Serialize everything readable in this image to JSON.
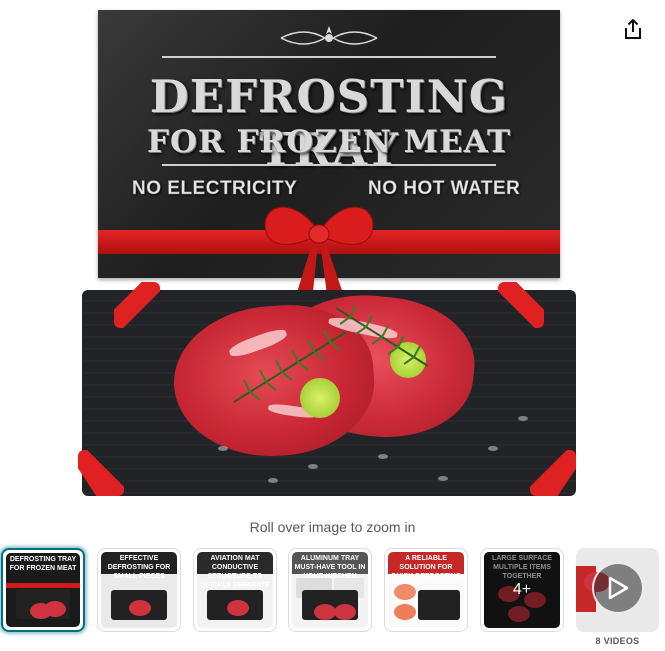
{
  "share": {
    "icon": "share-icon"
  },
  "product_image": {
    "title_line1": "DEFROSTING TRAY",
    "title_line2": "FOR FROZEN MEAT",
    "tag_left": "NO ELECTRICITY",
    "tag_right": "NO HOT WATER"
  },
  "zoom_hint": "Roll over image to zoom in",
  "thumbnails": [
    {
      "head": "DEFROSTING TRAY FOR FROZEN MEAT",
      "color": "#1a1a1a",
      "selected": true
    },
    {
      "head": "EFFECTIVE DEFROSTING FOR SMALL PIECES",
      "color": "#222222"
    },
    {
      "head": "AVIATION MAT CONDUCTIVE STRUCTURE TO QUICKLY SEPARATE MOISTURE",
      "color": "#2a2a2a"
    },
    {
      "head": "ALUMINUM TRAY MUST-HAVE TOOL IN YOUR KITCHEN",
      "color": "#f3f3f3"
    },
    {
      "head": "A RELIABLE SOLUTION FOR QUICK DEFROSTING",
      "color": "#c62828"
    },
    {
      "head": "LARGE SURFACE MULTIPLE ITEMS TOGETHER",
      "color": "#1f1f1f",
      "overlay": "4+"
    }
  ],
  "video": {
    "label": "8 VIDEOS",
    "icon": "play-icon"
  }
}
